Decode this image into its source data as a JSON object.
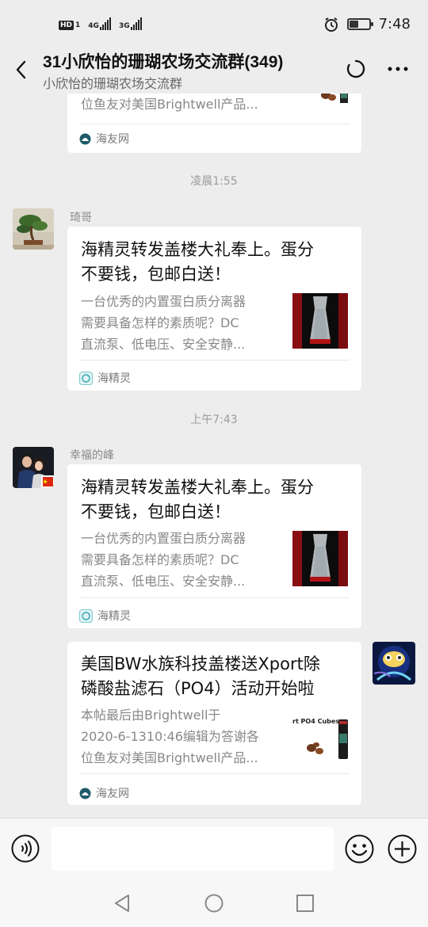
{
  "status_bar": {
    "hd_label": "HD",
    "hd_number": "1",
    "net1": "4G",
    "net2": "3G",
    "alarm_icon": "alarm-icon",
    "battery_level": 0.45,
    "time": "7:48"
  },
  "header": {
    "title": "31小欣怡的珊瑚农场交流群(349)",
    "subtitle": "小欣怡的珊瑚农场交流群",
    "icons": [
      "back-arrow-icon",
      "refresh-circle-icon",
      "more-dots-icon"
    ]
  },
  "messages": [
    {
      "card": {
        "desc_lines": [
          "位鱼友对美国Brightwell产品..."
        ],
        "source": "海友网",
        "source_icon": "haiyou-logo-icon"
      }
    },
    {
      "timestamp": "凌晨1:55",
      "sender": "琦哥",
      "avatar": "bonsai-avatar",
      "card": {
        "title_lines": [
          "海精灵转发盖楼大礼奉上。蛋分",
          "不要钱，包邮白送！"
        ],
        "desc_lines": [
          "一台优秀的内置蛋白质分离器",
          "需要具备怎样的素质呢？DC",
          "直流泵、低电压、安全安静..."
        ],
        "source": "海精灵",
        "source_icon": "haijingling-logo-icon"
      }
    },
    {
      "timestamp": "上午7:43",
      "sender": "幸福的峰",
      "avatar": "couple-avatar",
      "card": {
        "title_lines": [
          "海精灵转发盖楼大礼奉上。蛋分",
          "不要钱，包邮白送！"
        ],
        "desc_lines": [
          "一台优秀的内置蛋白质分离器",
          "需要具备怎样的素质呢？DC",
          "直流泵、低电压、安全安静..."
        ],
        "source": "海精灵",
        "source_icon": "haijingling-logo-icon"
      }
    },
    {
      "self": true,
      "avatar": "self-avatar",
      "card": {
        "title_lines": [
          "美国BW水族科技盖楼送Xport除",
          "磷酸盐滤石（PO4）活动开始啦"
        ],
        "desc_lines": [
          "本帖最后由Brightwell于",
          "2020-6-1310:46编辑为答谢各",
          "位鱼友对美国Brightwell产品..."
        ],
        "thumb_text": "rt PO4 Cubes",
        "source": "海友网",
        "source_icon": "haiyou-logo-icon"
      }
    }
  ],
  "input_bar": {
    "placeholder": "",
    "icons": [
      "voice-icon",
      "emoji-icon",
      "plus-icon"
    ]
  },
  "nav_bar": {
    "icons": [
      "nav-back-icon",
      "nav-home-icon",
      "nav-recent-icon"
    ]
  },
  "colors": {
    "background": "#ededed",
    "card": "#ffffff",
    "muted_text": "#888888"
  }
}
